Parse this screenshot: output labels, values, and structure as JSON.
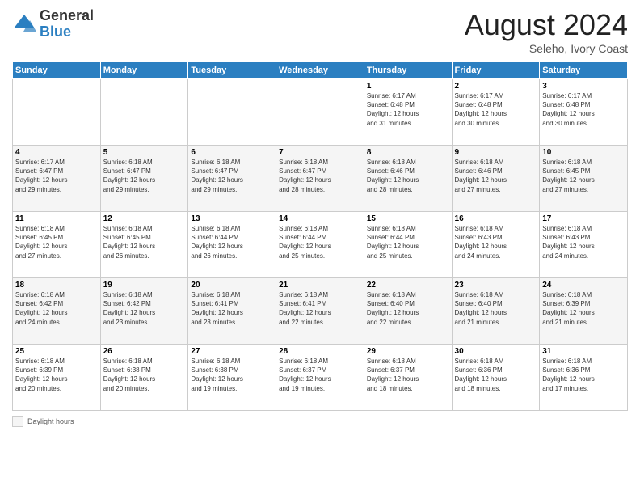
{
  "header": {
    "logo_general": "General",
    "logo_blue": "Blue",
    "title": "August 2024",
    "location": "Seleho, Ivory Coast"
  },
  "days_of_week": [
    "Sunday",
    "Monday",
    "Tuesday",
    "Wednesday",
    "Thursday",
    "Friday",
    "Saturday"
  ],
  "weeks": [
    [
      {
        "day": "",
        "info": ""
      },
      {
        "day": "",
        "info": ""
      },
      {
        "day": "",
        "info": ""
      },
      {
        "day": "",
        "info": ""
      },
      {
        "day": "1",
        "info": "Sunrise: 6:17 AM\nSunset: 6:48 PM\nDaylight: 12 hours\nand 31 minutes."
      },
      {
        "day": "2",
        "info": "Sunrise: 6:17 AM\nSunset: 6:48 PM\nDaylight: 12 hours\nand 30 minutes."
      },
      {
        "day": "3",
        "info": "Sunrise: 6:17 AM\nSunset: 6:48 PM\nDaylight: 12 hours\nand 30 minutes."
      }
    ],
    [
      {
        "day": "4",
        "info": "Sunrise: 6:17 AM\nSunset: 6:47 PM\nDaylight: 12 hours\nand 29 minutes."
      },
      {
        "day": "5",
        "info": "Sunrise: 6:18 AM\nSunset: 6:47 PM\nDaylight: 12 hours\nand 29 minutes."
      },
      {
        "day": "6",
        "info": "Sunrise: 6:18 AM\nSunset: 6:47 PM\nDaylight: 12 hours\nand 29 minutes."
      },
      {
        "day": "7",
        "info": "Sunrise: 6:18 AM\nSunset: 6:47 PM\nDaylight: 12 hours\nand 28 minutes."
      },
      {
        "day": "8",
        "info": "Sunrise: 6:18 AM\nSunset: 6:46 PM\nDaylight: 12 hours\nand 28 minutes."
      },
      {
        "day": "9",
        "info": "Sunrise: 6:18 AM\nSunset: 6:46 PM\nDaylight: 12 hours\nand 27 minutes."
      },
      {
        "day": "10",
        "info": "Sunrise: 6:18 AM\nSunset: 6:45 PM\nDaylight: 12 hours\nand 27 minutes."
      }
    ],
    [
      {
        "day": "11",
        "info": "Sunrise: 6:18 AM\nSunset: 6:45 PM\nDaylight: 12 hours\nand 27 minutes."
      },
      {
        "day": "12",
        "info": "Sunrise: 6:18 AM\nSunset: 6:45 PM\nDaylight: 12 hours\nand 26 minutes."
      },
      {
        "day": "13",
        "info": "Sunrise: 6:18 AM\nSunset: 6:44 PM\nDaylight: 12 hours\nand 26 minutes."
      },
      {
        "day": "14",
        "info": "Sunrise: 6:18 AM\nSunset: 6:44 PM\nDaylight: 12 hours\nand 25 minutes."
      },
      {
        "day": "15",
        "info": "Sunrise: 6:18 AM\nSunset: 6:44 PM\nDaylight: 12 hours\nand 25 minutes."
      },
      {
        "day": "16",
        "info": "Sunrise: 6:18 AM\nSunset: 6:43 PM\nDaylight: 12 hours\nand 24 minutes."
      },
      {
        "day": "17",
        "info": "Sunrise: 6:18 AM\nSunset: 6:43 PM\nDaylight: 12 hours\nand 24 minutes."
      }
    ],
    [
      {
        "day": "18",
        "info": "Sunrise: 6:18 AM\nSunset: 6:42 PM\nDaylight: 12 hours\nand 24 minutes."
      },
      {
        "day": "19",
        "info": "Sunrise: 6:18 AM\nSunset: 6:42 PM\nDaylight: 12 hours\nand 23 minutes."
      },
      {
        "day": "20",
        "info": "Sunrise: 6:18 AM\nSunset: 6:41 PM\nDaylight: 12 hours\nand 23 minutes."
      },
      {
        "day": "21",
        "info": "Sunrise: 6:18 AM\nSunset: 6:41 PM\nDaylight: 12 hours\nand 22 minutes."
      },
      {
        "day": "22",
        "info": "Sunrise: 6:18 AM\nSunset: 6:40 PM\nDaylight: 12 hours\nand 22 minutes."
      },
      {
        "day": "23",
        "info": "Sunrise: 6:18 AM\nSunset: 6:40 PM\nDaylight: 12 hours\nand 21 minutes."
      },
      {
        "day": "24",
        "info": "Sunrise: 6:18 AM\nSunset: 6:39 PM\nDaylight: 12 hours\nand 21 minutes."
      }
    ],
    [
      {
        "day": "25",
        "info": "Sunrise: 6:18 AM\nSunset: 6:39 PM\nDaylight: 12 hours\nand 20 minutes."
      },
      {
        "day": "26",
        "info": "Sunrise: 6:18 AM\nSunset: 6:38 PM\nDaylight: 12 hours\nand 20 minutes."
      },
      {
        "day": "27",
        "info": "Sunrise: 6:18 AM\nSunset: 6:38 PM\nDaylight: 12 hours\nand 19 minutes."
      },
      {
        "day": "28",
        "info": "Sunrise: 6:18 AM\nSunset: 6:37 PM\nDaylight: 12 hours\nand 19 minutes."
      },
      {
        "day": "29",
        "info": "Sunrise: 6:18 AM\nSunset: 6:37 PM\nDaylight: 12 hours\nand 18 minutes."
      },
      {
        "day": "30",
        "info": "Sunrise: 6:18 AM\nSunset: 6:36 PM\nDaylight: 12 hours\nand 18 minutes."
      },
      {
        "day": "31",
        "info": "Sunrise: 6:18 AM\nSunset: 6:36 PM\nDaylight: 12 hours\nand 17 minutes."
      }
    ]
  ],
  "footer": {
    "label": "Daylight hours"
  }
}
